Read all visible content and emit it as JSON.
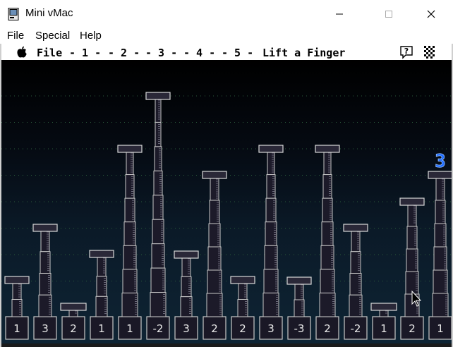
{
  "window": {
    "title": "Mini vMac"
  },
  "win_menu": [
    {
      "label": "File",
      "key": "file"
    },
    {
      "label": "Special",
      "key": "special"
    },
    {
      "label": "Help",
      "key": "help"
    }
  ],
  "mac_menu": {
    "apple_icon": "apple-icon",
    "items": [
      {
        "label": "File",
        "key": "file"
      },
      {
        "label": "- 1 -",
        "key": "1"
      },
      {
        "label": "- 2 -",
        "key": "2"
      },
      {
        "label": "- 3 -",
        "key": "3"
      },
      {
        "label": "- 4 -",
        "key": "4"
      },
      {
        "label": "- 5 -",
        "key": "5"
      },
      {
        "label": "Lift a Finger",
        "key": "lift-a-finger"
      }
    ],
    "help_icon": "help-icon",
    "extra_icon": "application-icon"
  },
  "game": {
    "highlight_value": "3",
    "highlight_color": "#1e6cff",
    "columns": [
      {
        "value": "1",
        "height": 57
      },
      {
        "value": "3",
        "height": 131
      },
      {
        "value": "2",
        "height": 19
      },
      {
        "value": "1",
        "height": 94
      },
      {
        "value": "1",
        "height": 243
      },
      {
        "value": "-2",
        "height": 318
      },
      {
        "value": "3",
        "height": 93
      },
      {
        "value": "2",
        "height": 206
      },
      {
        "value": "2",
        "height": 57
      },
      {
        "value": "3",
        "height": 243
      },
      {
        "value": "-3",
        "height": 56
      },
      {
        "value": "2",
        "height": 243
      },
      {
        "value": "-2",
        "height": 131
      },
      {
        "value": "1",
        "height": 19
      },
      {
        "value": "2",
        "height": 168
      },
      {
        "value": "1",
        "height": 206
      }
    ]
  }
}
